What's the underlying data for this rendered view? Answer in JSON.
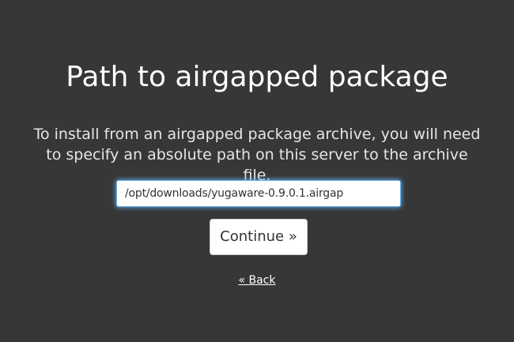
{
  "page": {
    "title": "Path to airgapped package",
    "description": "To install from an airgapped package archive, you will need to specify an absolute path on this server to the archive file."
  },
  "form": {
    "path_value": "/opt/downloads/yugaware-0.9.0.1.airgap",
    "continue_label": "Continue »",
    "back_label": "« Back"
  },
  "colors": {
    "background": "#373737",
    "text": "#ffffff",
    "focus_ring": "#66afe9"
  }
}
